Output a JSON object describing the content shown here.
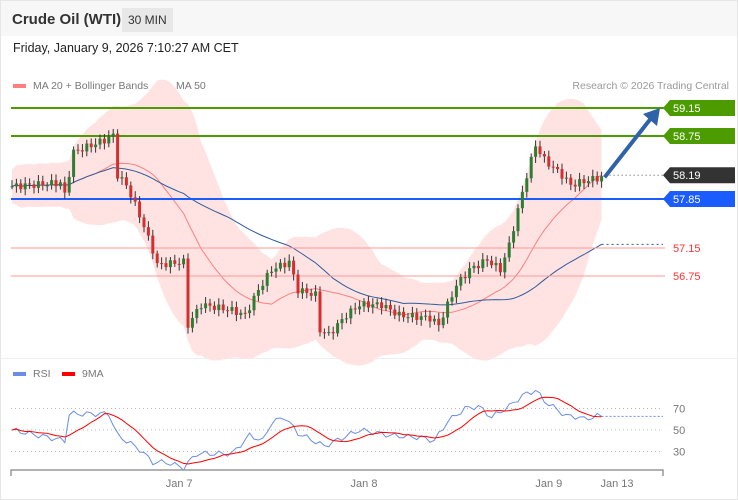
{
  "header": {
    "title": "Crude Oil (WTI)",
    "timeframe": "30 MIN"
  },
  "timestamp": "Friday, January 9, 2026 7:10:27 AM CET",
  "legend": {
    "bb": "MA 20 + Bollinger Bands",
    "ma50": "MA 50",
    "rsi": "RSI",
    "rsi_ma": "9MA"
  },
  "credit": "Research © 2026 Trading Central",
  "colors": {
    "bb": "#ff7f7f",
    "ma50": "#2f5c9b",
    "up": "#2e7d32",
    "down": "#d32f2f",
    "resistance": "#4c9c00",
    "pivot": "#1a5cff",
    "support": "#ff3333",
    "last": "#333333",
    "rsi": "#6a8ee6",
    "rsi_ma": "#ff0000"
  },
  "chart_data": {
    "type": "candlestick",
    "title": "Crude Oil (WTI) 30 MIN",
    "ylim": [
      55.55,
      59.5
    ],
    "x_ticks": [
      {
        "label": "Jan 7",
        "index": 38
      },
      {
        "label": "Jan 8",
        "index": 80
      },
      {
        "label": "Jan 9",
        "index": 122
      },
      {
        "label": "Jan 13",
        "index": 137.5
      }
    ],
    "close_path": [
      [
        0,
        58.03
      ],
      [
        11,
        58.08
      ],
      [
        12,
        57.91
      ],
      [
        14,
        58.52
      ],
      [
        21,
        58.69
      ],
      [
        23,
        58.76
      ],
      [
        24,
        58.19
      ],
      [
        26,
        58.05
      ],
      [
        29,
        57.62
      ],
      [
        32,
        57.12
      ],
      [
        33,
        56.91
      ],
      [
        39,
        56.95
      ],
      [
        40,
        56.05
      ],
      [
        43,
        56.34
      ],
      [
        50,
        56.26
      ],
      [
        53,
        56.19
      ],
      [
        56,
        56.55
      ],
      [
        59,
        56.84
      ],
      [
        63,
        56.95
      ],
      [
        65,
        56.55
      ],
      [
        69,
        56.48
      ],
      [
        70,
        55.98
      ],
      [
        72,
        55.91
      ],
      [
        76,
        56.19
      ],
      [
        79,
        56.34
      ],
      [
        84,
        56.34
      ],
      [
        88,
        56.19
      ],
      [
        95,
        56.15
      ],
      [
        97,
        56.05
      ],
      [
        101,
        56.62
      ],
      [
        104,
        56.84
      ],
      [
        108,
        56.98
      ],
      [
        111,
        56.84
      ],
      [
        113,
        57.19
      ],
      [
        115,
        57.69
      ],
      [
        117,
        58.19
      ],
      [
        119,
        58.62
      ],
      [
        121,
        58.41
      ],
      [
        125,
        58.19
      ],
      [
        127,
        58.05
      ],
      [
        131,
        58.12
      ],
      [
        134,
        58.16
      ]
    ],
    "levels": [
      {
        "label": "59.15",
        "value": 59.15,
        "type": "resistance"
      },
      {
        "label": "58.75",
        "value": 58.75,
        "type": "resistance"
      },
      {
        "label": "58.19",
        "value": 58.19,
        "type": "last"
      },
      {
        "label": "57.85",
        "value": 57.85,
        "type": "pivot"
      },
      {
        "label": "57.15",
        "value": 57.15,
        "type": "support"
      },
      {
        "label": "56.75",
        "value": 56.75,
        "type": "support"
      }
    ],
    "target_arrow": {
      "from": 58.16,
      "to": 59.15
    },
    "rsi": {
      "ticks": [
        70,
        50,
        30
      ],
      "path": [
        [
          0,
          50
        ],
        [
          12,
          40
        ],
        [
          13,
          65
        ],
        [
          22,
          65
        ],
        [
          24,
          45
        ],
        [
          29,
          32
        ],
        [
          32,
          20
        ],
        [
          35,
          20
        ],
        [
          39,
          15
        ],
        [
          42,
          28
        ],
        [
          50,
          28
        ],
        [
          54,
          45
        ],
        [
          57,
          40
        ],
        [
          59,
          57
        ],
        [
          62,
          62
        ],
        [
          65,
          47
        ],
        [
          71,
          35
        ],
        [
          79,
          50
        ],
        [
          86,
          45
        ],
        [
          93,
          43
        ],
        [
          96,
          40
        ],
        [
          99,
          58
        ],
        [
          103,
          70
        ],
        [
          106,
          72
        ],
        [
          109,
          62
        ],
        [
          113,
          72
        ],
        [
          116,
          82
        ],
        [
          119,
          87
        ],
        [
          121,
          77
        ],
        [
          126,
          63
        ],
        [
          129,
          62
        ],
        [
          130,
          60
        ],
        [
          133,
          63
        ]
      ]
    }
  }
}
